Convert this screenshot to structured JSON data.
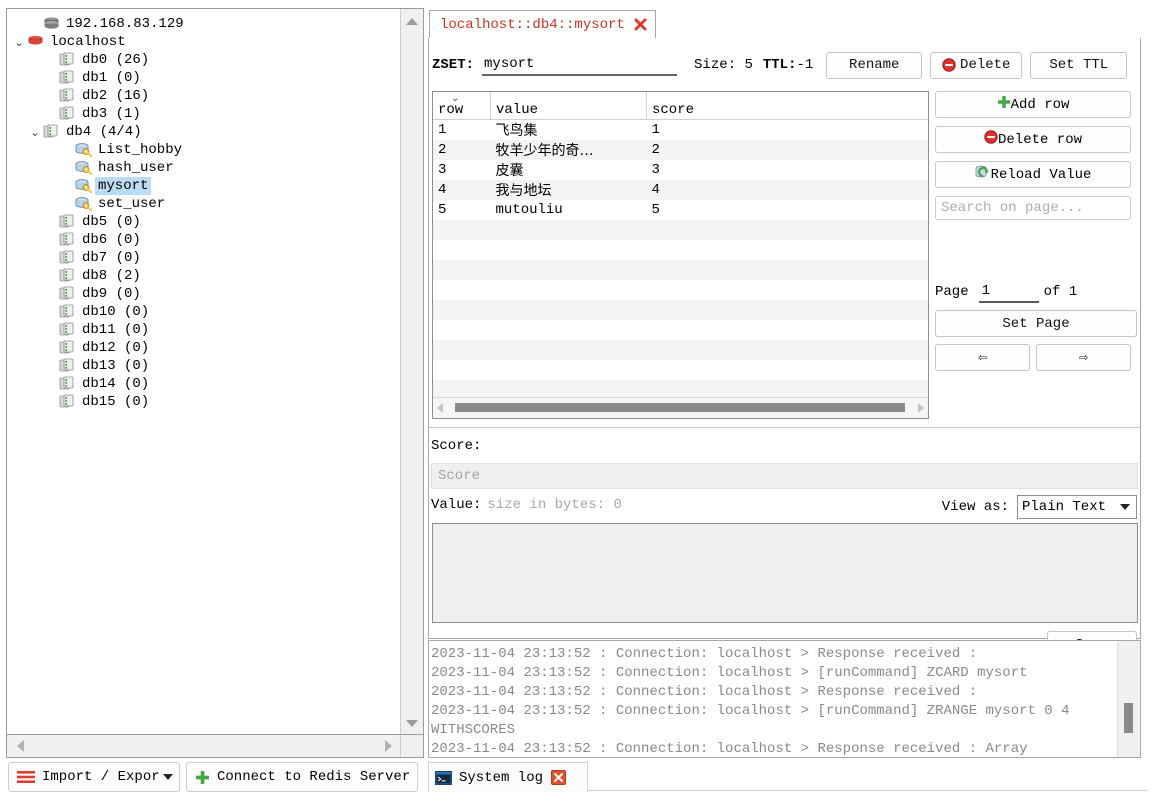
{
  "tree": {
    "nodes": [
      {
        "label": "192.168.83.129",
        "icon": "server-grey-icon",
        "depth": 1,
        "twisty": "",
        "selected": false
      },
      {
        "label": "localhost",
        "icon": "server-red-icon",
        "depth": 0,
        "twisty": "expanded",
        "selected": false
      },
      {
        "label": "db0  (26)",
        "icon": "database-icon",
        "depth": 2,
        "twisty": "",
        "selected": false
      },
      {
        "label": "db1  (0)",
        "icon": "database-icon",
        "depth": 2,
        "twisty": "",
        "selected": false
      },
      {
        "label": "db2  (16)",
        "icon": "database-icon",
        "depth": 2,
        "twisty": "",
        "selected": false
      },
      {
        "label": "db3  (1)",
        "icon": "database-icon",
        "depth": 2,
        "twisty": "",
        "selected": false
      },
      {
        "label": "db4   (4/4)",
        "icon": "database-icon",
        "depth": 1,
        "twisty": "expanded",
        "selected": false
      },
      {
        "label": "List_hobby",
        "icon": "key-icon",
        "depth": 3,
        "twisty": "",
        "selected": false
      },
      {
        "label": "hash_user",
        "icon": "key-icon",
        "depth": 3,
        "twisty": "",
        "selected": false
      },
      {
        "label": "mysort",
        "icon": "key-icon",
        "depth": 3,
        "twisty": "",
        "selected": true
      },
      {
        "label": "set_user",
        "icon": "key-icon",
        "depth": 3,
        "twisty": "",
        "selected": false
      },
      {
        "label": "db5  (0)",
        "icon": "database-icon",
        "depth": 2,
        "twisty": "",
        "selected": false
      },
      {
        "label": "db6  (0)",
        "icon": "database-icon",
        "depth": 2,
        "twisty": "",
        "selected": false
      },
      {
        "label": "db7  (0)",
        "icon": "database-icon",
        "depth": 2,
        "twisty": "",
        "selected": false
      },
      {
        "label": "db8  (2)",
        "icon": "database-icon",
        "depth": 2,
        "twisty": "",
        "selected": false
      },
      {
        "label": "db9  (0)",
        "icon": "database-icon",
        "depth": 2,
        "twisty": "",
        "selected": false
      },
      {
        "label": "db10  (0)",
        "icon": "database-icon",
        "depth": 2,
        "twisty": "",
        "selected": false
      },
      {
        "label": "db11  (0)",
        "icon": "database-icon",
        "depth": 2,
        "twisty": "",
        "selected": false
      },
      {
        "label": "db12  (0)",
        "icon": "database-icon",
        "depth": 2,
        "twisty": "",
        "selected": false
      },
      {
        "label": "db13  (0)",
        "icon": "database-icon",
        "depth": 2,
        "twisty": "",
        "selected": false
      },
      {
        "label": "db14  (0)",
        "icon": "database-icon",
        "depth": 2,
        "twisty": "",
        "selected": false
      },
      {
        "label": "db15  (0)",
        "icon": "database-icon",
        "depth": 2,
        "twisty": "",
        "selected": false
      }
    ]
  },
  "tab": {
    "title": "localhost::db4::mysort",
    "close_icon": "close-x-icon",
    "title_color": "#cc3322"
  },
  "key_toolbar": {
    "type_label": "ZSET:",
    "key_name": "mysort",
    "size_label": "Size:",
    "size_value": "5",
    "ttl_label": "TTL:",
    "ttl_value": "-1",
    "rename_label": "Rename",
    "delete_label": "Delete",
    "set_ttl_label": "Set TTL"
  },
  "table": {
    "columns": [
      "row",
      "value",
      "score"
    ],
    "sort_indicator": "chevron-down",
    "rows": [
      {
        "row": "1",
        "value": "飞鸟集",
        "score": "1",
        "cjk": true
      },
      {
        "row": "2",
        "value": "牧羊少年的奇…",
        "score": "2",
        "cjk": true
      },
      {
        "row": "3",
        "value": "皮囊",
        "score": "3",
        "cjk": true
      },
      {
        "row": "4",
        "value": "我与地坛",
        "score": "4",
        "cjk": true
      },
      {
        "row": "5",
        "value": "mutouliu",
        "score": "5",
        "cjk": false
      }
    ],
    "empty_row_count": 13
  },
  "side_actions": {
    "add_row_label": "Add row",
    "delete_row_label": "Delete row",
    "reload_value_label": "Reload Value",
    "search_placeholder": "Search on page..."
  },
  "pager": {
    "page_label": "Page",
    "page_value": "1",
    "of_label": "of 1",
    "set_page_label": "Set Page",
    "prev_label": "⇦",
    "next_label": "⇨"
  },
  "score_section": {
    "label": "Score:",
    "placeholder": "Score",
    "value": ""
  },
  "value_section": {
    "label": "Value:",
    "size_text": "size in bytes: 0",
    "view_as_label": "View as:",
    "view_as_value": "Plain Text",
    "view_as_options": [
      "Plain Text"
    ],
    "textarea_value": "",
    "save_label": "Save"
  },
  "log": {
    "text": "2023-11-04 23:13:52 : Connection: localhost > Response received :\n2023-11-04 23:13:52 : Connection: localhost > [runCommand] ZCARD mysort\n2023-11-04 23:13:52 : Connection: localhost > Response received :\n2023-11-04 23:13:52 : Connection: localhost > [runCommand] ZRANGE mysort 0 4 WITHSCORES\n2023-11-04 23:13:52 : Connection: localhost > Response received : Array"
  },
  "bottom_bar": {
    "import_export_label": "Import / Expor",
    "connect_label": "Connect to Redis Server",
    "system_log_label": "System log"
  },
  "colors": {
    "accent_red": "#cc3322",
    "selection_blue": "#bcdcf4",
    "panel_border": "#a8a8a8",
    "stripe": "#f4f4f4",
    "log_text": "#8a8a8a"
  }
}
